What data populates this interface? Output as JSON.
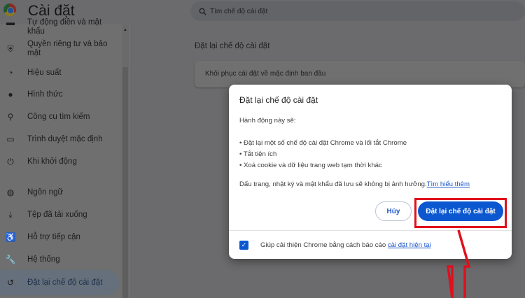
{
  "header": {
    "title": "Cài đặt",
    "search_placeholder": "Tìm chế độ cài đặt"
  },
  "sidebar": {
    "items": [
      {
        "label": "Tự động điền và mật khẩu",
        "icon": "autofill-icon"
      },
      {
        "label": "Quyền riêng tư và bảo mật",
        "icon": "shield-icon"
      },
      {
        "label": "Hiệu suất",
        "icon": "speedometer-icon"
      },
      {
        "label": "Hình thức",
        "icon": "palette-icon"
      },
      {
        "label": "Công cụ tìm kiếm",
        "icon": "search-icon"
      },
      {
        "label": "Trình duyệt mặc định",
        "icon": "browser-icon"
      },
      {
        "label": "Khi khởi động",
        "icon": "power-icon"
      },
      {
        "label": "Ngôn ngữ",
        "icon": "globe-icon"
      },
      {
        "label": "Tệp đã tải xuống",
        "icon": "download-icon"
      },
      {
        "label": "Hỗ trợ tiếp cận",
        "icon": "accessibility-icon"
      },
      {
        "label": "Hệ thống",
        "icon": "wrench-icon"
      },
      {
        "label": "Đặt lại chế độ cài đặt",
        "icon": "history-icon"
      }
    ]
  },
  "main": {
    "section_label": "Đặt lại chế độ cài đặt",
    "card_label": "Khôi phục cài đặt về mặc định ban đầu"
  },
  "dialog": {
    "title": "Đặt lại chế độ cài đặt",
    "intro": "Hành động này sẽ:",
    "bullets": [
      "• Đặt lại một số chế độ cài đặt Chrome và lối tắt Chrome",
      "• Tắt tiện ích",
      "• Xoá cookie và dữ liệu trang web tạm thời khác"
    ],
    "note": "Dấu trang, nhật ký và mật khẩu đã lưu sẽ không bị ảnh hưởng.",
    "learn_more": "Tìm hiểu thêm",
    "cancel": "Hủy",
    "confirm": "Đặt lại chế độ cài đặt",
    "footer_text": "Giúp cải thiện Chrome bằng cách báo cáo ",
    "footer_link": "cài đặt hiện tại",
    "footer_checked": true
  },
  "colors": {
    "accent": "#0b57d0",
    "annotation": "#e0101c"
  }
}
